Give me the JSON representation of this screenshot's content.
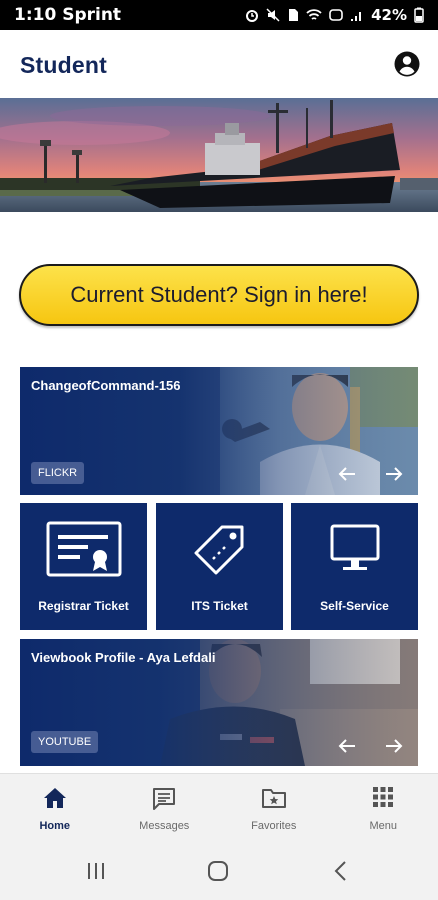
{
  "status_bar": {
    "time": "1:10 Sprint",
    "battery": "42%"
  },
  "header": {
    "title": "Student",
    "profile_icon": "account-circle-icon"
  },
  "banner": {
    "description_icon": "ship-harbor-sunset-image"
  },
  "signin": {
    "label": "Current Student? Sign in here!"
  },
  "cards": [
    {
      "title": "ChangeofCommand-156",
      "badge": "FLICKR"
    },
    {
      "title": "Viewbook Profile - Aya Lefdali",
      "badge": "YOUTUBE"
    }
  ],
  "tiles": [
    {
      "label": "Registrar Ticket",
      "icon": "certificate-icon"
    },
    {
      "label": "ITS Ticket",
      "icon": "tag-icon"
    },
    {
      "label": "Self-Service",
      "icon": "monitor-icon"
    }
  ],
  "bottom_nav": [
    {
      "label": "Home",
      "icon": "home-icon",
      "active": true
    },
    {
      "label": "Messages",
      "icon": "message-icon"
    },
    {
      "label": "Favorites",
      "icon": "star-folder-icon"
    },
    {
      "label": "Menu",
      "icon": "grid-icon"
    }
  ],
  "colors": {
    "navy": "#0e2a6b",
    "title": "#13275a",
    "signin_yellow": "#f8d02a"
  }
}
